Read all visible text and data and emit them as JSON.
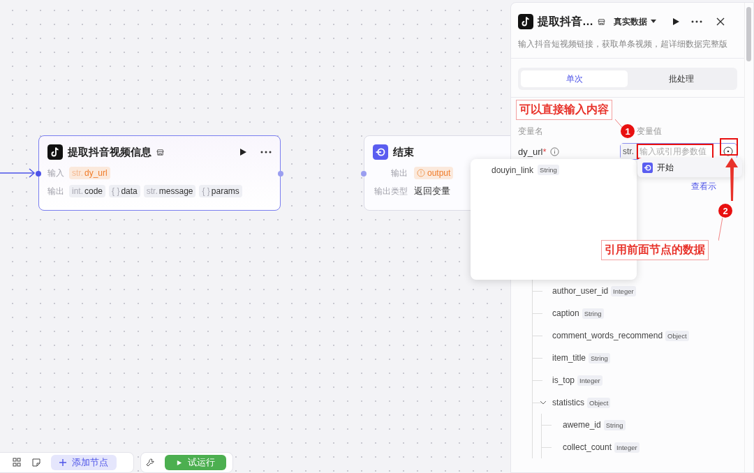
{
  "canvas": {
    "plugin_node": {
      "title": "提取抖音视频信息",
      "selected": true,
      "input_label": "输入",
      "inputs": [
        {
          "type": "str.",
          "name": "dy_url"
        }
      ],
      "output_label": "输出",
      "outputs": [
        {
          "type": "int.",
          "name": "code"
        },
        {
          "type": "{ }",
          "name": "data"
        },
        {
          "type": "str.",
          "name": "message"
        },
        {
          "type": "{ }",
          "name": "params"
        }
      ]
    },
    "end_node": {
      "title": "结束",
      "output_label": "输出",
      "output_tag": "output",
      "output_type_label": "输出类型",
      "output_type_value": "返回变量"
    },
    "toolbar": {
      "add_node": "添加节点",
      "test_run": "试运行"
    }
  },
  "panel": {
    "title": "提取抖音…",
    "data_mode": "真实数据",
    "description": "输入抖音短视频链接，获取单条视频，超详细数据完整版",
    "tabs": [
      {
        "label": "单次",
        "selected": true
      },
      {
        "label": "批处理",
        "selected": false
      }
    ],
    "column_headers": [
      "变量名",
      "变量值"
    ],
    "param": {
      "name": "dy_url",
      "required_mark": "*",
      "type": "str.",
      "placeholder": "输入或引用参数值"
    },
    "example_link": "查看示",
    "tree": [
      {
        "name": "author_user_id",
        "type": "Integer"
      },
      {
        "name": "caption",
        "type": "String"
      },
      {
        "name": "comment_words_recommend",
        "type": "Object"
      },
      {
        "name": "item_title",
        "type": "String"
      },
      {
        "name": "is_top",
        "type": "Integer"
      },
      {
        "name": "statistics",
        "type": "Object",
        "expanded": true,
        "children": [
          {
            "name": "aweme_id",
            "type": "String"
          },
          {
            "name": "collect_count",
            "type": "Integer"
          }
        ]
      }
    ]
  },
  "reference_menu": {
    "source": "开始",
    "variables": [
      {
        "name": "douyin_link",
        "type": "String"
      }
    ]
  },
  "annotations": [
    {
      "badge": "1",
      "text": "可以直接输入内容"
    },
    {
      "badge": "2",
      "text": "引用前面节点的数据"
    }
  ]
}
